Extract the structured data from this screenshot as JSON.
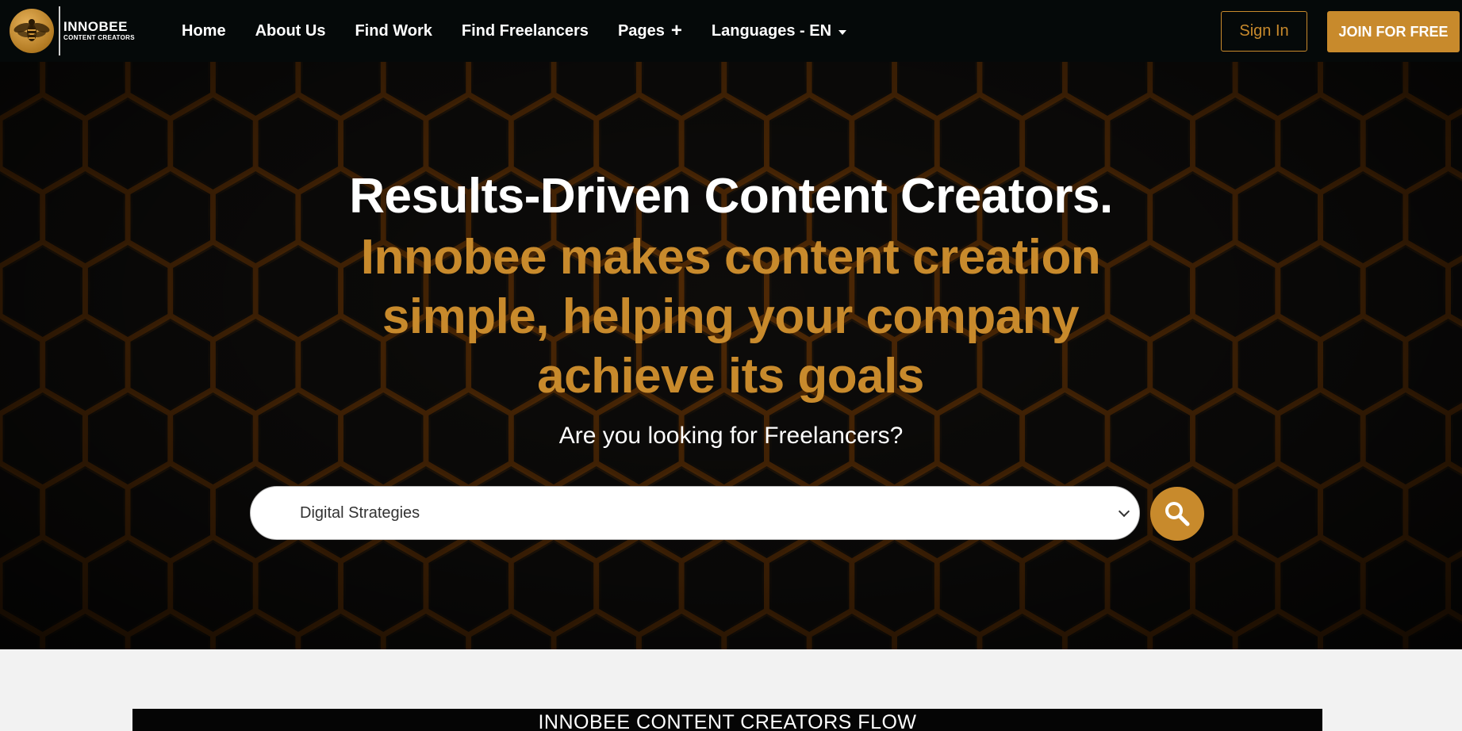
{
  "brand": {
    "title": "INNOBEE",
    "subtitle": "CONTENT CREATORS",
    "accent_color": "#c88a2c"
  },
  "nav": {
    "links": [
      {
        "label": "Home"
      },
      {
        "label": "About Us"
      },
      {
        "label": "Find Work"
      },
      {
        "label": "Find Freelancers"
      },
      {
        "label": "Pages"
      },
      {
        "label": "Languages - EN"
      }
    ],
    "sign_in_label": "Sign In",
    "join_label": "JOIN FOR FREE"
  },
  "hero": {
    "title": "Results-Driven Content Creators.",
    "subtitle": "Innobee makes content creation simple, helping your company achieve its goals",
    "question": "Are you looking for Freelancers?",
    "search_selected": "Digital Strategies",
    "search_icon": "search-icon"
  },
  "flow": {
    "title": "INNOBEE CONTENT CREATORS FLOW"
  }
}
